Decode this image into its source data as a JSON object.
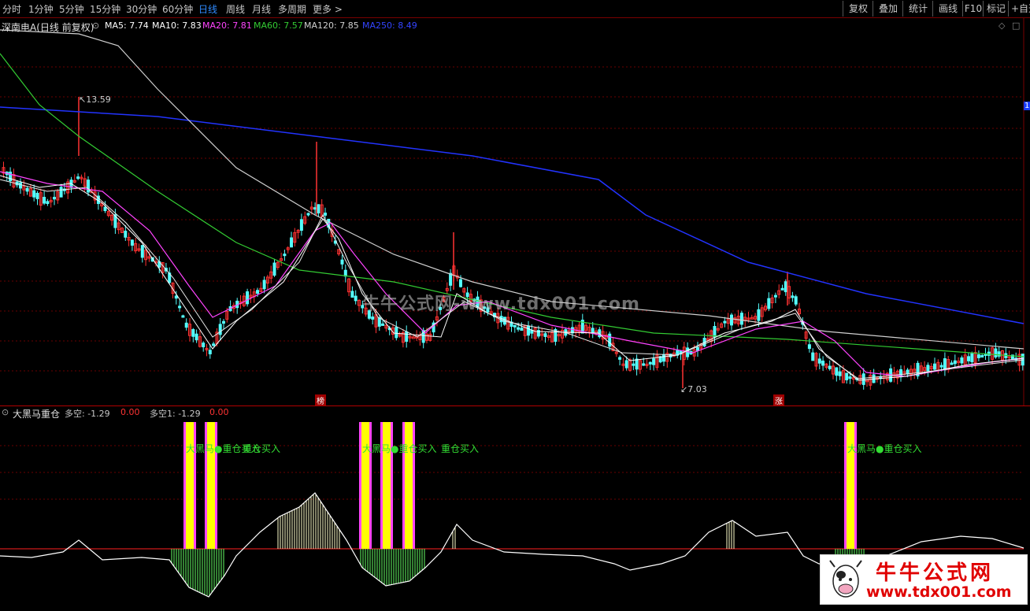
{
  "toolbar": {
    "timeframes": [
      "分时",
      "1分钟",
      "5分钟",
      "15分钟",
      "30分钟",
      "60分钟",
      "日线",
      "周线",
      "月线",
      "多周期",
      "更多 >"
    ],
    "active_timeframe": "日线",
    "right_buttons": [
      "复权",
      "叠加",
      "统计",
      "画线",
      "F10",
      "标记",
      "+自选"
    ]
  },
  "main_chart": {
    "stock_name": "深南电A(日线 前复权)",
    "ma_labels": [
      {
        "text": "MA5: 7.74",
        "color": "#ffffff"
      },
      {
        "text": "MA10: 7.83",
        "color": "#ffffff"
      },
      {
        "text": "MA20: 7.81",
        "color": "#ff44ff"
      },
      {
        "text": "MA60: 7.57",
        "color": "#33cc33"
      },
      {
        "text": "MA120: 7.85",
        "color": "#d0d0d0"
      },
      {
        "text": "MA250: 8.49",
        "color": "#3344ff"
      }
    ],
    "high_label": "13.59",
    "low_label": "7.03",
    "marker_bang": "榜",
    "marker_zhang": "涨",
    "right_edge_label": "1"
  },
  "sub_chart": {
    "indicator_name": "大黑马重仓",
    "labels": [
      {
        "text": "多空: -1.29",
        "color": "#c8c8c8"
      },
      {
        "text": "0.00",
        "color": "#ff3333"
      },
      {
        "text": "多空1: -1.29",
        "color": "#c8c8c8"
      },
      {
        "text": "0.00",
        "color": "#ff3333"
      }
    ],
    "signal_text": "大黑马●重仓买入",
    "signal_text_short": "重仓买入"
  },
  "watermark": "牛牛公式网-www.tdx001.com",
  "logo": {
    "title": "牛牛公式网",
    "url": "www.tdx001.com"
  },
  "colors": {
    "up": "#ff3232",
    "down": "#54ffff",
    "ma5": "#ffffff",
    "ma20": "#ff44ff",
    "ma60": "#33cc33",
    "ma120": "#d0d0d0",
    "ma250": "#2233ff",
    "signal_yellow": "#ffff00",
    "signal_magenta": "#ff44ff",
    "hist_up": "#ffffcc",
    "hist_down": "#66ff66"
  }
}
